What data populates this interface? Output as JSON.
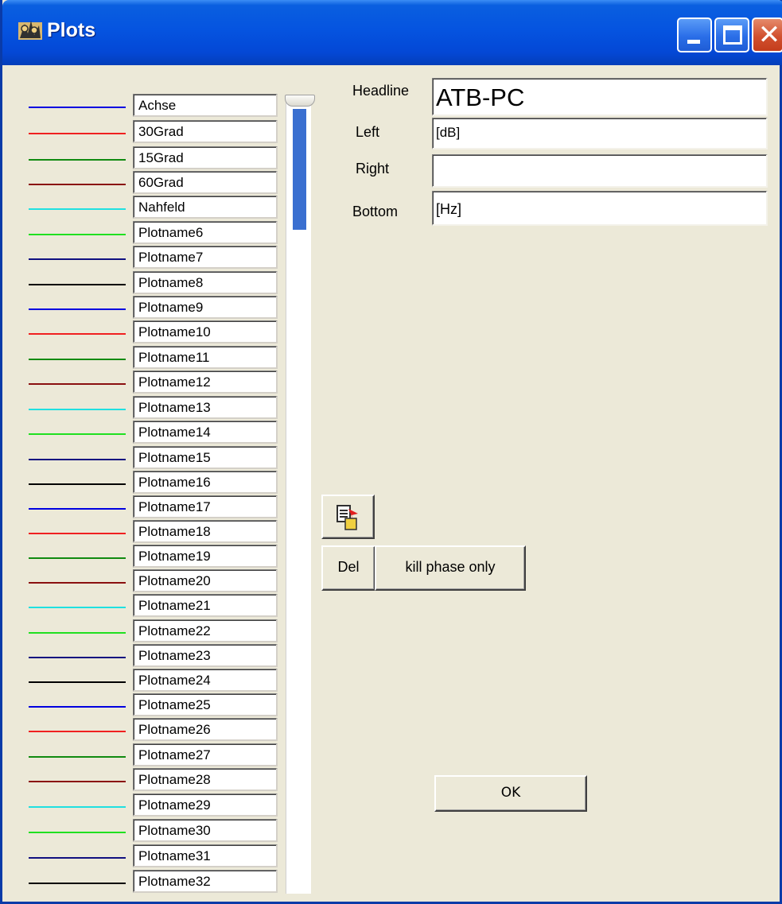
{
  "window": {
    "title": "Plots"
  },
  "plots": [
    {
      "name": "Achse",
      "color": "#0000e0"
    },
    {
      "name": "30Grad",
      "color": "#f02020"
    },
    {
      "name": " 15Grad",
      "color": "#108a10"
    },
    {
      "name": "60Grad",
      "color": "#8a1010"
    },
    {
      "name": "Nahfeld",
      "color": "#20e0e0"
    },
    {
      "name": "Plotname6",
      "color": "#20e020"
    },
    {
      "name": "Plotname7",
      "color": "#101080"
    },
    {
      "name": "Plotname8",
      "color": "#000000"
    },
    {
      "name": "Plotname9",
      "color": "#0000e0"
    },
    {
      "name": "Plotname10",
      "color": "#f02020"
    },
    {
      "name": "Plotname11",
      "color": "#108a10"
    },
    {
      "name": "Plotname12",
      "color": "#8a1010"
    },
    {
      "name": "Plotname13",
      "color": "#20e0e0"
    },
    {
      "name": "Plotname14",
      "color": "#20e020"
    },
    {
      "name": "Plotname15",
      "color": "#101080"
    },
    {
      "name": "Plotname16",
      "color": "#000000"
    },
    {
      "name": "Plotname17",
      "color": "#0000e0"
    },
    {
      "name": "Plotname18",
      "color": "#f02020"
    },
    {
      "name": "Plotname19",
      "color": "#108a10"
    },
    {
      "name": "Plotname20",
      "color": "#8a1010"
    },
    {
      "name": "Plotname21",
      "color": "#20e0e0"
    },
    {
      "name": "Plotname22",
      "color": "#20e020"
    },
    {
      "name": "Plotname23",
      "color": "#101080"
    },
    {
      "name": "Plotname24",
      "color": "#000000"
    },
    {
      "name": "Plotname25",
      "color": "#0000e0"
    },
    {
      "name": "Plotname26",
      "color": "#f02020"
    },
    {
      "name": "Plotname27",
      "color": "#108a10"
    },
    {
      "name": "Plotname28",
      "color": "#8a1010"
    },
    {
      "name": "Plotname29",
      "color": "#20e0e0"
    },
    {
      "name": "Plotname30",
      "color": "#20e020"
    },
    {
      "name": "Plotname31",
      "color": "#101080"
    },
    {
      "name": "Plotname32",
      "color": "#000000"
    }
  ],
  "form": {
    "headline": {
      "label": "Headline",
      "value": "ATB-PC"
    },
    "left": {
      "label": "Left",
      "value": "[dB]"
    },
    "right": {
      "label": "Right",
      "value": ""
    },
    "bottom": {
      "label": "Bottom",
      "value": "[Hz]"
    }
  },
  "buttons": {
    "copy_icon": "copy-paste-icon",
    "del": "Del",
    "kill_phase": "kill phase only",
    "ok": "OK"
  }
}
